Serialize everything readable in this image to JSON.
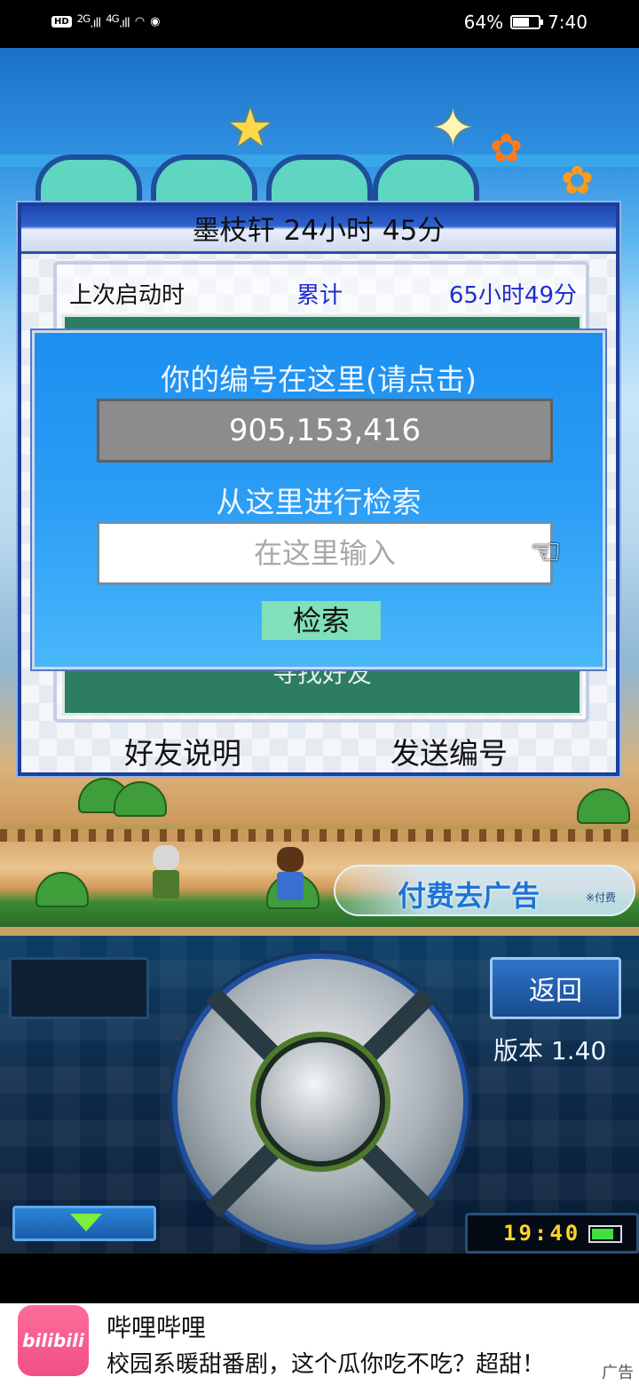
{
  "status_bar": {
    "hd_badge": "HD",
    "sim1": "2G",
    "sim2": "4G",
    "battery_percent": "64%",
    "battery_level": 0.64,
    "time": "7:40"
  },
  "panel": {
    "title": "墨枝轩  24小时 45分",
    "last_launch_label": "上次启动时",
    "total_label": "累计",
    "total_value": "65小时49分",
    "find_friend_label": "寻找好友",
    "friend_help_label": "好友说明",
    "send_id_label": "发送编号"
  },
  "dialog": {
    "title": "你的编号在这里(请点击)",
    "player_id": "905,153,416",
    "search_heading": "从这里进行检索",
    "search_placeholder": "在这里输入",
    "search_button": "检索"
  },
  "remove_ads": {
    "label": "付费去广告",
    "note": "※付费"
  },
  "controller": {
    "back_button": "返回",
    "version": "版本 1.40",
    "clock": "19:40",
    "battery_level": 0.8
  },
  "ad": {
    "app_icon_text": "bilibili",
    "app_name": "哔哩哔哩",
    "description": "校园系暖甜番剧，这个瓜你吃不吃？超甜！",
    "tag": "广告"
  }
}
